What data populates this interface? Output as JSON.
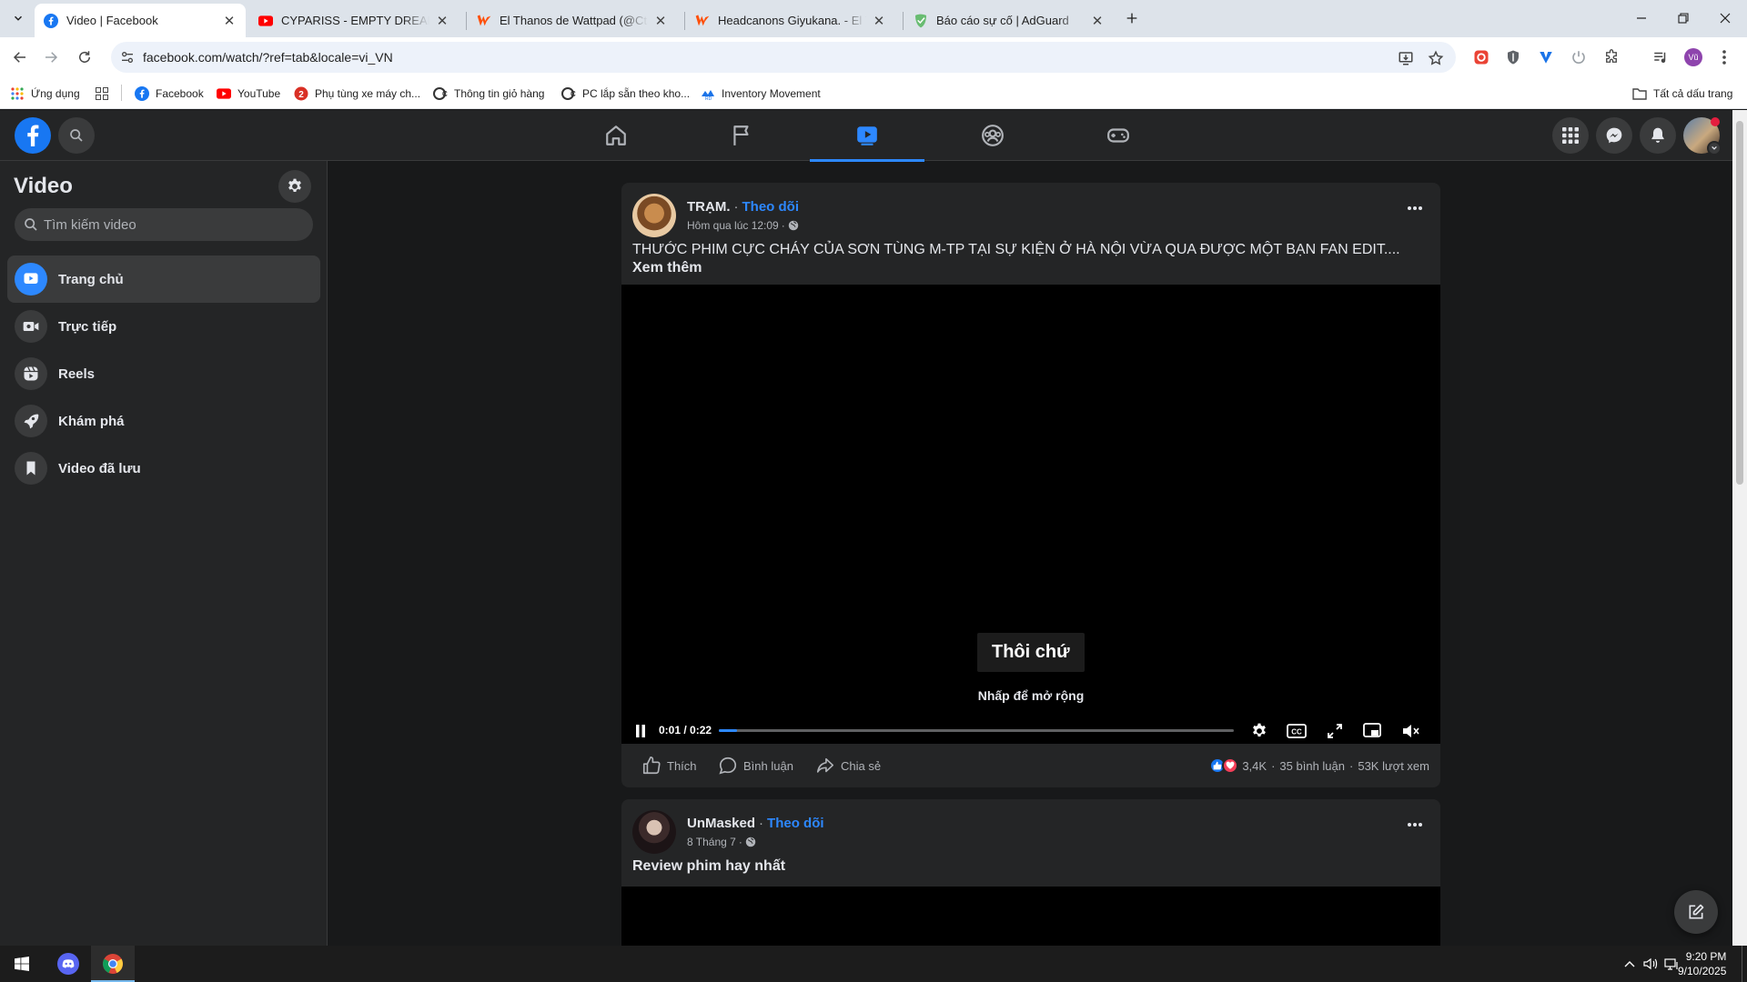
{
  "browser": {
    "tabs": [
      {
        "title": "Video | Facebook",
        "active": true,
        "favicon": "facebook-icon"
      },
      {
        "title": "CYPARISS - EMPTY DREAMS (ft.",
        "active": false,
        "favicon": "youtube-icon"
      },
      {
        "title": "El Thanos de Wattpad (@Ctaran",
        "active": false,
        "favicon": "wattpad-icon"
      },
      {
        "title": "Headcanons Giyukana. - El Than",
        "active": false,
        "favicon": "wattpad-icon"
      },
      {
        "title": "Báo cáo sự cố | AdGuard",
        "active": false,
        "favicon": "adguard-shield-icon"
      }
    ],
    "url": "facebook.com/watch/?ref=tab&locale=vi_VN",
    "profile_initial": "Vũ",
    "bookmarks": [
      {
        "label": "Ứng dụng",
        "icon": "apps-grid-icon"
      },
      {
        "label": "",
        "icon": "tab-groups-icon"
      },
      {
        "label": "Facebook",
        "icon": "facebook-icon"
      },
      {
        "label": "YouTube",
        "icon": "youtube-icon"
      },
      {
        "label": "Phụ tùng xe máy ch...",
        "icon": "parts-icon"
      },
      {
        "label": "Thông tin giỏ hàng",
        "icon": "cart-site-icon"
      },
      {
        "label": "PC lắp sẵn theo kho...",
        "icon": "pc-site-icon"
      },
      {
        "label": "Inventory Movement",
        "icon": "inventory-icon"
      }
    ],
    "all_bookmarks": "Tất cả dấu trang"
  },
  "sidebar": {
    "title": "Video",
    "search_placeholder": "Tìm kiếm video",
    "items": [
      {
        "label": "Trang chủ",
        "icon": "video-play-icon",
        "active": true
      },
      {
        "label": "Trực tiếp",
        "icon": "live-camera-icon",
        "active": false
      },
      {
        "label": "Reels",
        "icon": "reels-icon",
        "active": false
      },
      {
        "label": "Khám phá",
        "icon": "rocket-icon",
        "active": false
      },
      {
        "label": "Video đã lưu",
        "icon": "bookmark-icon",
        "active": false
      }
    ]
  },
  "posts": [
    {
      "author": "TRẠM.",
      "follow": "Theo dõi",
      "time": "Hôm qua lúc 12:09",
      "text": "THƯỚC PHIM CỰC CHÁY CỦA SƠN TÙNG M-TP TẠI SỰ KIỆN Ở HÀ NỘI VỪA QUA ĐƯỢC MỘT BẠN FAN EDIT....",
      "see_more": "Xem thêm",
      "video": {
        "caption": "Thôi chứ",
        "expand_hint": "Nhấp để mở rộng",
        "time": "0:01 / 0:22",
        "progress": 0.035
      },
      "actions": {
        "like": "Thích",
        "comment": "Bình luận",
        "share": "Chia sẻ"
      },
      "reactions": "3,4K",
      "comments": "35 bình luận",
      "views": "53K lượt xem"
    },
    {
      "author": "UnMasked",
      "follow": "Theo dõi",
      "time": "8 Tháng 7",
      "text": "Review phim hay nhất"
    }
  ],
  "taskbar": {
    "time": "9:20 PM",
    "date": "9/10/2025"
  },
  "colors": {
    "fb_blue": "#2d88ff",
    "fb_dark": "#18191a",
    "fb_card": "#242526"
  }
}
